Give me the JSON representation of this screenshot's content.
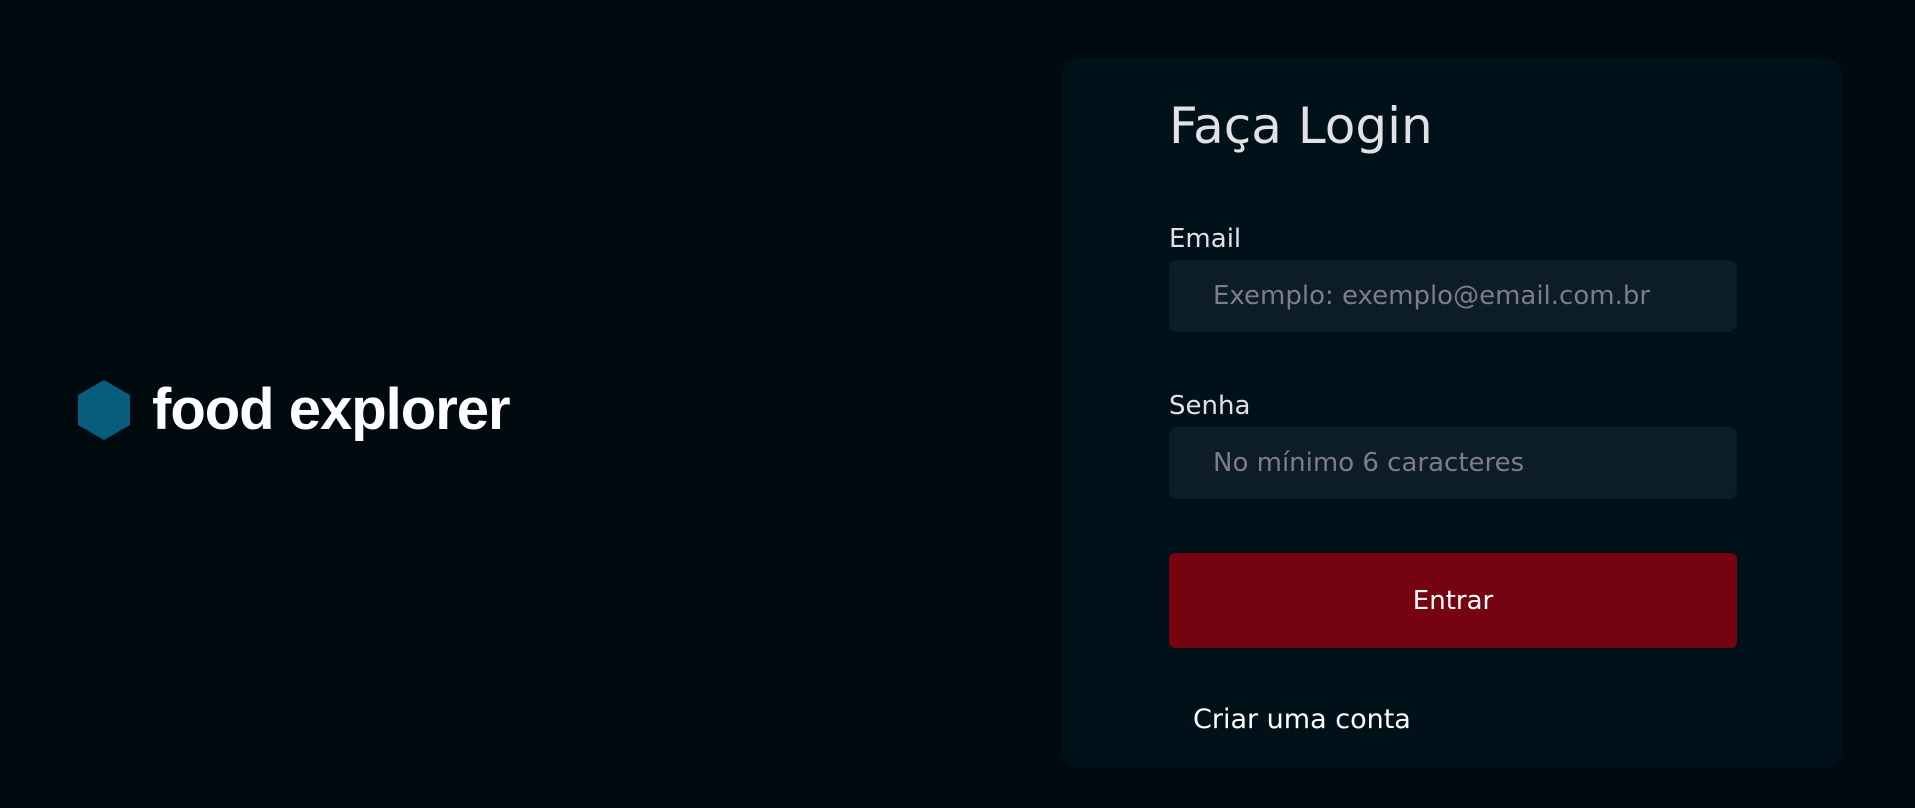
{
  "brand": {
    "name": "food explorer",
    "logo_icon": "hexagon-icon",
    "logo_color": "#065e7c"
  },
  "login": {
    "title": "Faça Login",
    "email": {
      "label": "Email",
      "value": "",
      "placeholder": "Exemplo: exemplo@email.com.br"
    },
    "password": {
      "label": "Senha",
      "value": "",
      "placeholder": "No mínimo 6 caracteres"
    },
    "submit_label": "Entrar",
    "signup_link": "Criar uma conta"
  },
  "colors": {
    "background": "#000a0f",
    "card": "#001119",
    "input": "#0d1d25",
    "button": "#750310",
    "text": "#e1e1e6",
    "placeholder": "#7c7c8a"
  }
}
